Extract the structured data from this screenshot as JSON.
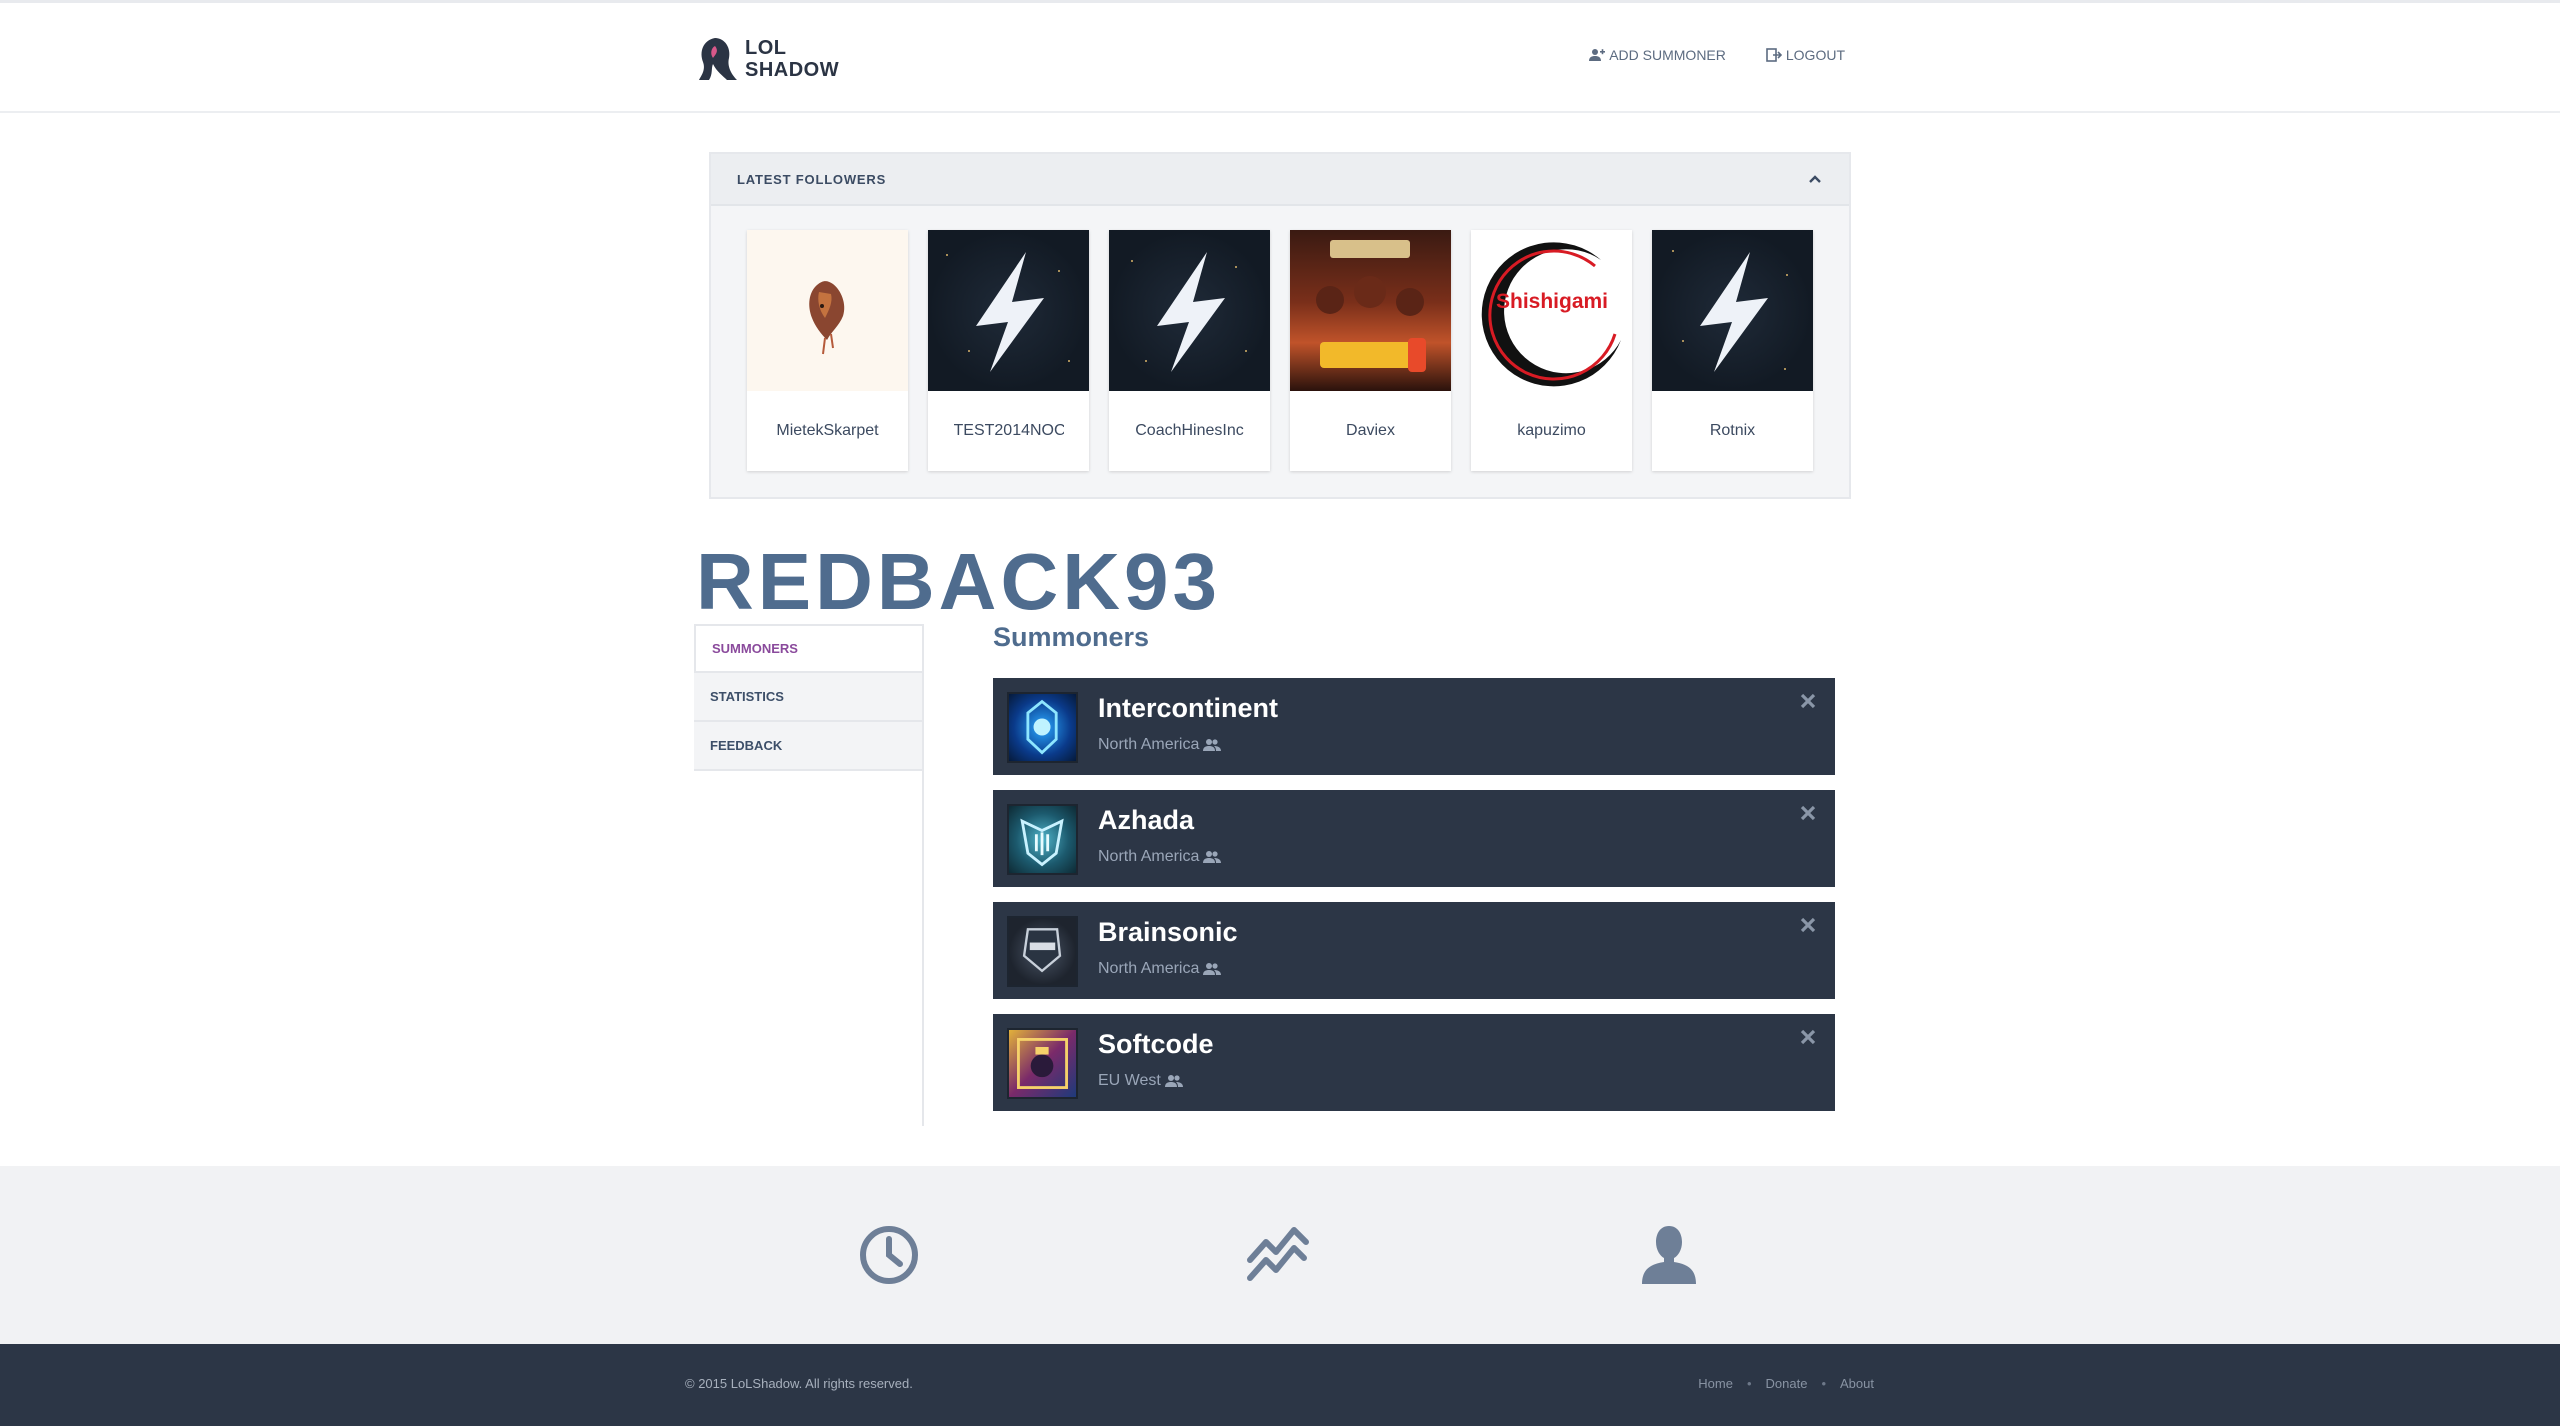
{
  "brand": {
    "line1": "LOL",
    "line2": "SHADOW"
  },
  "nav": {
    "add_summoner": "ADD SUMMONER",
    "logout": "LOGOUT"
  },
  "followers_panel": {
    "title": "LATEST FOLLOWERS",
    "items": [
      {
        "name": "MietekSkarpet",
        "icon": "wolf-painting"
      },
      {
        "name": "TEST2014NOC",
        "icon": "lightning-bolt"
      },
      {
        "name": "CoachHinesInc",
        "icon": "lightning-bolt"
      },
      {
        "name": "Daviex",
        "icon": "rayman3-cover"
      },
      {
        "name": "kapuzimo",
        "icon": "shishigami-logo"
      },
      {
        "name": "Rotnix",
        "icon": "lightning-bolt"
      }
    ],
    "shishigami_logo_text": "Shishigami"
  },
  "profile": {
    "username": "REDBACK93"
  },
  "side_menu": {
    "items": [
      "SUMMONERS",
      "STATISTICS",
      "FEEDBACK"
    ],
    "active": "SUMMONERS"
  },
  "summoners": {
    "title": "Summoners",
    "list": [
      {
        "name": "Intercontinent",
        "region": "North America"
      },
      {
        "name": "Azhada",
        "region": "North America"
      },
      {
        "name": "Brainsonic",
        "region": "North America"
      },
      {
        "name": "Softcode",
        "region": "EU West"
      }
    ]
  },
  "features": [
    "clock-icon",
    "chart-line-icon",
    "user-icon"
  ],
  "footer": {
    "copyright": "© 2015 LoLShadow. All rights reserved.",
    "links": [
      "Home",
      "Donate",
      "About"
    ]
  },
  "colors": {
    "dark": "#2c3646",
    "title": "#4f6c8e",
    "active_menu": "#8a4a9c"
  }
}
